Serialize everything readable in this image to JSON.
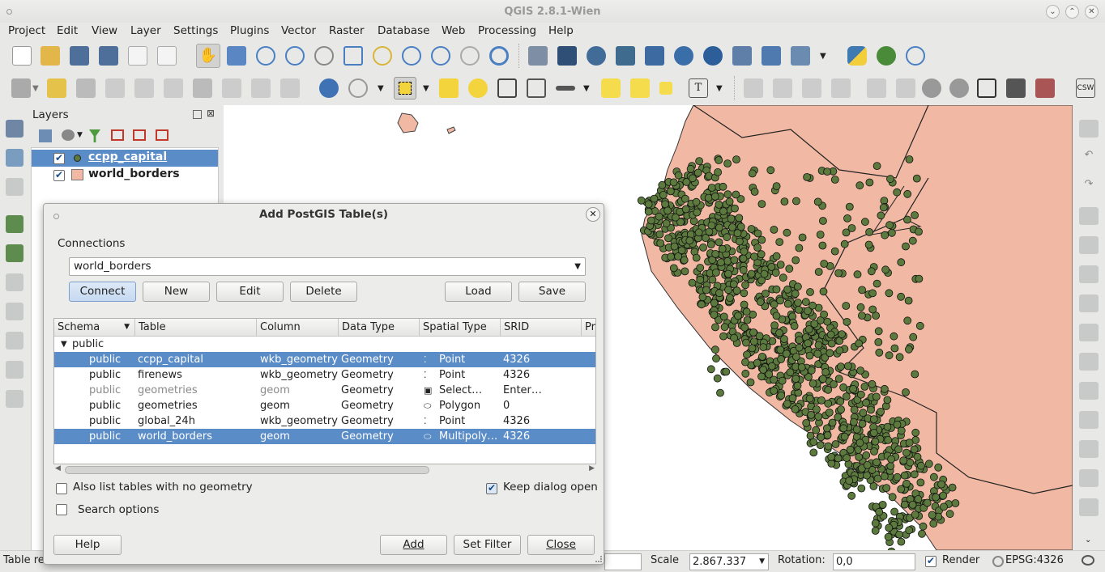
{
  "app": {
    "title": "QGIS 2.8.1-Wien"
  },
  "menubar": [
    "Project",
    "Edit",
    "View",
    "Layer",
    "Settings",
    "Plugins",
    "Vector",
    "Raster",
    "Database",
    "Web",
    "Processing",
    "Help"
  ],
  "layers_panel": {
    "title": "Layers",
    "layers": [
      {
        "name": "ccpp_capital",
        "checked": true,
        "selected": true
      },
      {
        "name": "world_borders",
        "checked": true,
        "selected": false
      }
    ]
  },
  "dialog": {
    "title": "Add PostGIS Table(s)",
    "connections_label": "Connections",
    "connection_value": "world_borders",
    "buttons": {
      "connect": "Connect",
      "new": "New",
      "edit": "Edit",
      "delete": "Delete",
      "load": "Load",
      "save": "Save"
    },
    "columns": [
      "Schema",
      "Table",
      "Column",
      "Data Type",
      "Spatial Type",
      "SRID",
      "Pr"
    ],
    "group": "public",
    "rows": [
      {
        "schema": "public",
        "table": "ccpp_capital",
        "column": "wkb_geometry",
        "dtype": "Geometry",
        "stype": "Point",
        "srid": "4326",
        "state": "selected"
      },
      {
        "schema": "public",
        "table": "firenews",
        "column": "wkb_geometry",
        "dtype": "Geometry",
        "stype": "Point",
        "srid": "4326",
        "state": "normal"
      },
      {
        "schema": "public",
        "table": "geometries",
        "column": "geom",
        "dtype": "Geometry",
        "stype": "Select…",
        "srid": "Enter…",
        "state": "dim"
      },
      {
        "schema": "public",
        "table": "geometries",
        "column": "geom",
        "dtype": "Geometry",
        "stype": "Polygon",
        "srid": "0",
        "state": "normal"
      },
      {
        "schema": "public",
        "table": "global_24h",
        "column": "wkb_geometry",
        "dtype": "Geometry",
        "stype": "Point",
        "srid": "4326",
        "state": "normal"
      },
      {
        "schema": "public",
        "table": "world_borders",
        "column": "geom",
        "dtype": "Geometry",
        "stype": "Multipoly…",
        "srid": "4326",
        "state": "selected"
      }
    ],
    "also_list_label": "Also list tables with no geometry",
    "keep_open_label": "Keep dialog open",
    "search_options_label": "Search options",
    "footer": {
      "help": "Help",
      "add": "Add",
      "set_filter": "Set Filter",
      "close": "Close"
    }
  },
  "status": {
    "left_text": "Table re",
    "scale_label": "Scale",
    "scale_value": "2.867.337",
    "rotation_label": "Rotation:",
    "rotation_value": "0,0",
    "render_label": "Render",
    "crs": "EPSG:4326"
  },
  "colors": {
    "land": "#f1b8a3",
    "points": "#5d7a3e",
    "selection": "#5a8cc8"
  }
}
